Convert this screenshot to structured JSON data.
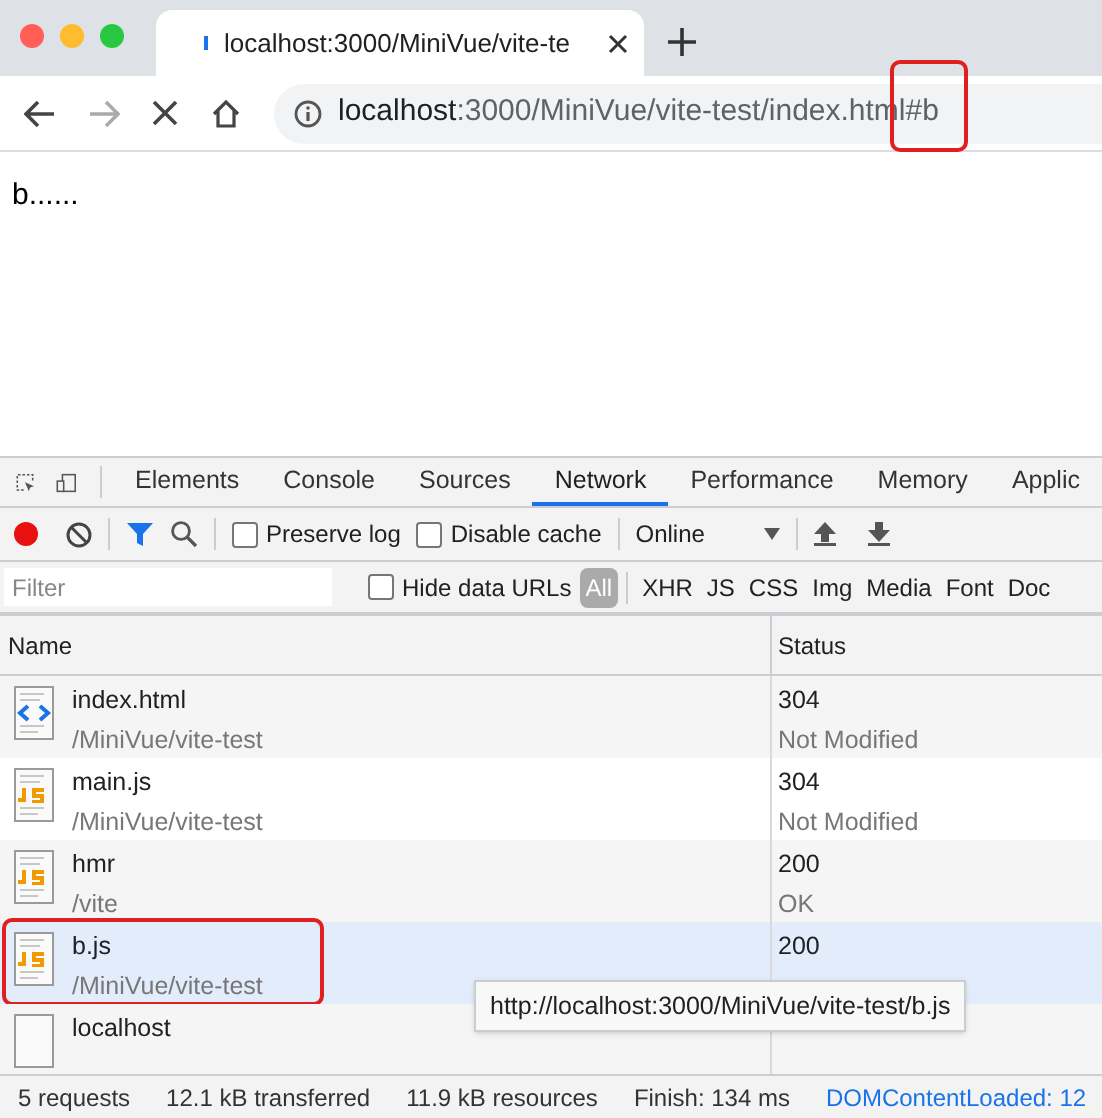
{
  "browser_tab": {
    "title": "localhost:3000/MiniVue/vite-te",
    "loading": true
  },
  "address_bar": {
    "host": "localhost",
    "rest": ":3000/MiniVue/vite-test/index.html",
    "fragment": "#b",
    "fragment_highlighted": true
  },
  "page": {
    "text": "b......"
  },
  "devtools": {
    "tabs": [
      {
        "label": "Elements",
        "selected": false
      },
      {
        "label": "Console",
        "selected": false
      },
      {
        "label": "Sources",
        "selected": false
      },
      {
        "label": "Network",
        "selected": true
      },
      {
        "label": "Performance",
        "selected": false
      },
      {
        "label": "Memory",
        "selected": false
      },
      {
        "label": "Applic",
        "selected": false
      }
    ],
    "recording": true,
    "preserve_log": {
      "label": "Preserve log",
      "checked": false
    },
    "disable_cache": {
      "label": "Disable cache",
      "checked": false
    },
    "throttling": "Online",
    "filter": {
      "placeholder": "Filter"
    },
    "hide_data_urls": {
      "label": "Hide data URLs",
      "checked": false
    },
    "type_filters": [
      {
        "label": "All",
        "selected": true
      },
      {
        "label": "XHR",
        "selected": false
      },
      {
        "label": "JS",
        "selected": false
      },
      {
        "label": "CSS",
        "selected": false
      },
      {
        "label": "Img",
        "selected": false
      },
      {
        "label": "Media",
        "selected": false
      },
      {
        "label": "Font",
        "selected": false
      },
      {
        "label": "Doc",
        "selected": false
      }
    ],
    "columns": [
      "Name",
      "Status"
    ],
    "rows": [
      {
        "kind": "html",
        "name": "index.html",
        "path": "/MiniVue/vite-test",
        "status": "304",
        "status_text": "Not Modified",
        "selected": false,
        "highlighted": false
      },
      {
        "kind": "js",
        "name": "main.js",
        "path": "/MiniVue/vite-test",
        "status": "304",
        "status_text": "Not Modified",
        "selected": false,
        "highlighted": false
      },
      {
        "kind": "js",
        "name": "hmr",
        "path": "/vite",
        "status": "200",
        "status_text": "OK",
        "selected": false,
        "highlighted": false
      },
      {
        "kind": "js",
        "name": "b.js",
        "path": "/MiniVue/vite-test",
        "status": "200",
        "selected": true,
        "highlighted": true
      },
      {
        "kind": "blank",
        "name": "localhost",
        "selected": false,
        "highlighted": false
      }
    ],
    "tooltip": "http://localhost:3000/MiniVue/vite-test/b.js",
    "summary": [
      {
        "text": "5 requests",
        "kind": "plain"
      },
      {
        "text": "12.1 kB transferred",
        "kind": "plain"
      },
      {
        "text": "11.9 kB resources",
        "kind": "plain"
      },
      {
        "text": "Finish: 134 ms",
        "kind": "plain"
      },
      {
        "text": "DOMContentLoaded: 12",
        "kind": "link"
      }
    ]
  }
}
